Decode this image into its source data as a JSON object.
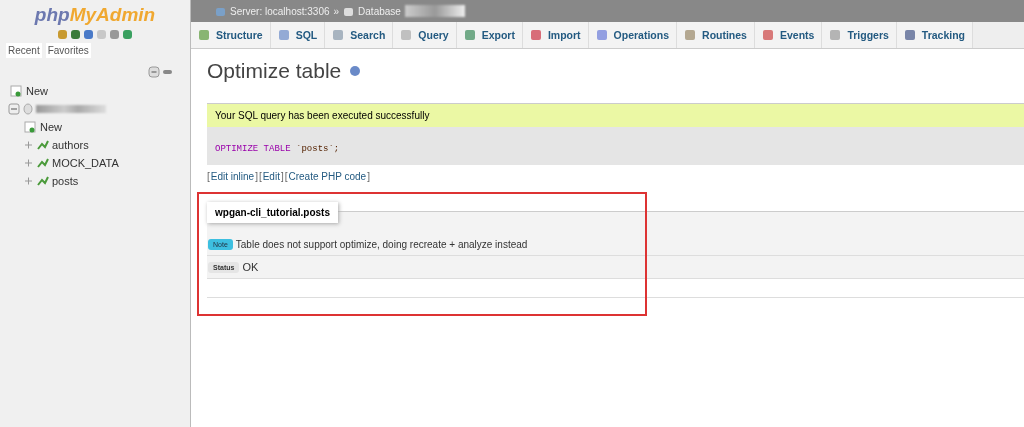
{
  "sidebar": {
    "logo": {
      "part_1": "php",
      "part_2": "MyAdmin"
    },
    "tabs": [
      {
        "label": "Recent",
        "selected": false
      },
      {
        "label": "Favorites",
        "selected": false
      }
    ],
    "tree": [
      {
        "label": "New",
        "kind": "new"
      },
      {
        "kind": "database",
        "expanded": true,
        "children": [
          {
            "label": "New",
            "kind": "new"
          },
          {
            "label": "authors",
            "kind": "table",
            "expanded": false
          },
          {
            "label": "MOCK_DATA",
            "kind": "table",
            "expanded": false
          },
          {
            "label": "posts",
            "kind": "table",
            "expanded": false
          }
        ]
      }
    ]
  },
  "breadcrumb": [
    {
      "label": "Server: localhost:3306"
    },
    {
      "separator": "»",
      "label": "Database"
    }
  ],
  "tabs": [
    {
      "label": "Structure",
      "selected": false
    },
    {
      "label": "SQL",
      "selected": false
    },
    {
      "label": "Search",
      "selected": false
    },
    {
      "label": "Query",
      "selected": false
    },
    {
      "label": "Export",
      "selected": false
    },
    {
      "label": "Import",
      "selected": false
    },
    {
      "label": "Operations",
      "selected": false
    },
    {
      "label": "Routines",
      "selected": false
    },
    {
      "label": "Events",
      "selected": false
    },
    {
      "label": "Triggers",
      "selected": false
    },
    {
      "label": "Tracking",
      "selected": false
    }
  ],
  "page_title": "Optimize table",
  "success_message": "Your SQL query has been executed successfully",
  "sql": {
    "keyword": "OPTIMIZE TABLE",
    "name": "`posts`;"
  },
  "links": [
    {
      "open": "[",
      "label": "Edit inline",
      "close": "]"
    },
    {
      "open": "[",
      "label": "Edit",
      "close": "]"
    },
    {
      "open": "[",
      "label": "Create PHP code",
      "close": "]"
    }
  ],
  "result": {
    "title": "wpgan-cli_tutorial.posts",
    "rows": [
      {
        "badge": "Note",
        "kind": "note",
        "text": "Table does not support optimize, doing recreate + analyze instead"
      },
      {
        "badge": "Status",
        "kind": "status",
        "text": "OK"
      }
    ]
  }
}
